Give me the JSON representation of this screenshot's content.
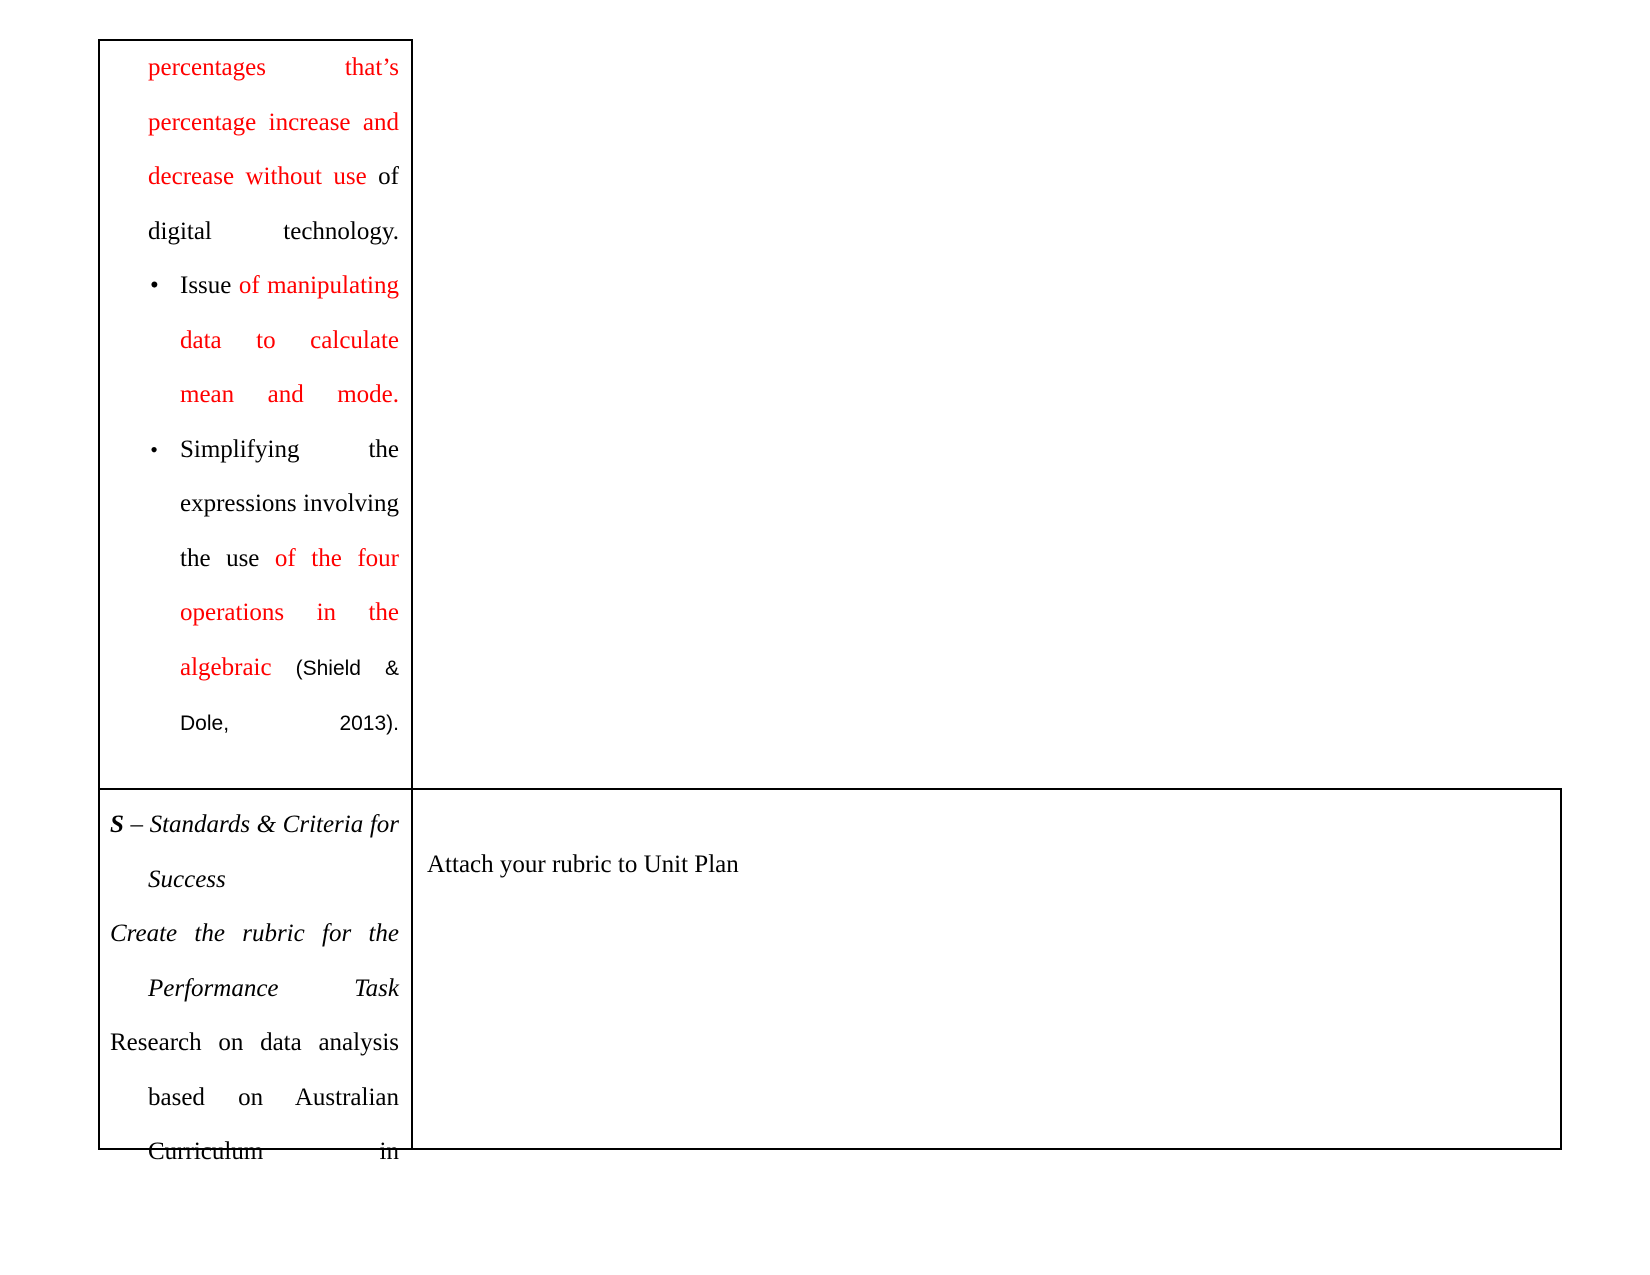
{
  "document": {
    "type": "unit-plan-table-fragment",
    "colors": {
      "highlight": "#ff0000",
      "body": "#000000",
      "border": "#000000"
    }
  },
  "top_cell": {
    "paragraph_1": {
      "segments": [
        {
          "text": "percentages that’s percentage increase and decrease without use",
          "color": "red"
        },
        {
          "text": " of digital technology.",
          "color": "black"
        }
      ],
      "plain": "percentages that’s percentage increase and decrease without use of digital technology."
    },
    "bullets": [
      {
        "marker": "•",
        "marker_style": "round",
        "segments": [
          {
            "text": "Issue ",
            "color": "black"
          },
          {
            "text": "of manipulating data to calculate mean and mode.",
            "color": "red"
          }
        ],
        "plain": "Issue of manipulating data to calculate mean and mode."
      },
      {
        "marker": "•",
        "marker_style": "italic-round",
        "segments": [
          {
            "text": "Simplifying the expressions involving the use ",
            "color": "black"
          },
          {
            "text": "of the four operations in the algebraic",
            "color": "red"
          },
          {
            "text": " (Shield & Dole, 2013).",
            "color": "black",
            "font": "sans"
          }
        ],
        "plain": "Simplifying the expressions involving the use of the four operations in the algebraic (Shield & Dole, 2013)."
      }
    ]
  },
  "bottom_table": {
    "left_cell": {
      "heading_prefix": "S",
      "heading_rest": " – Standards & Criteria for Success",
      "subheading": "Create the rubric for the Performance Task",
      "body": "Research on data analysis based on Australian Curriculum in"
    },
    "right_cell": {
      "text": "Attach your rubric to Unit Plan"
    }
  }
}
